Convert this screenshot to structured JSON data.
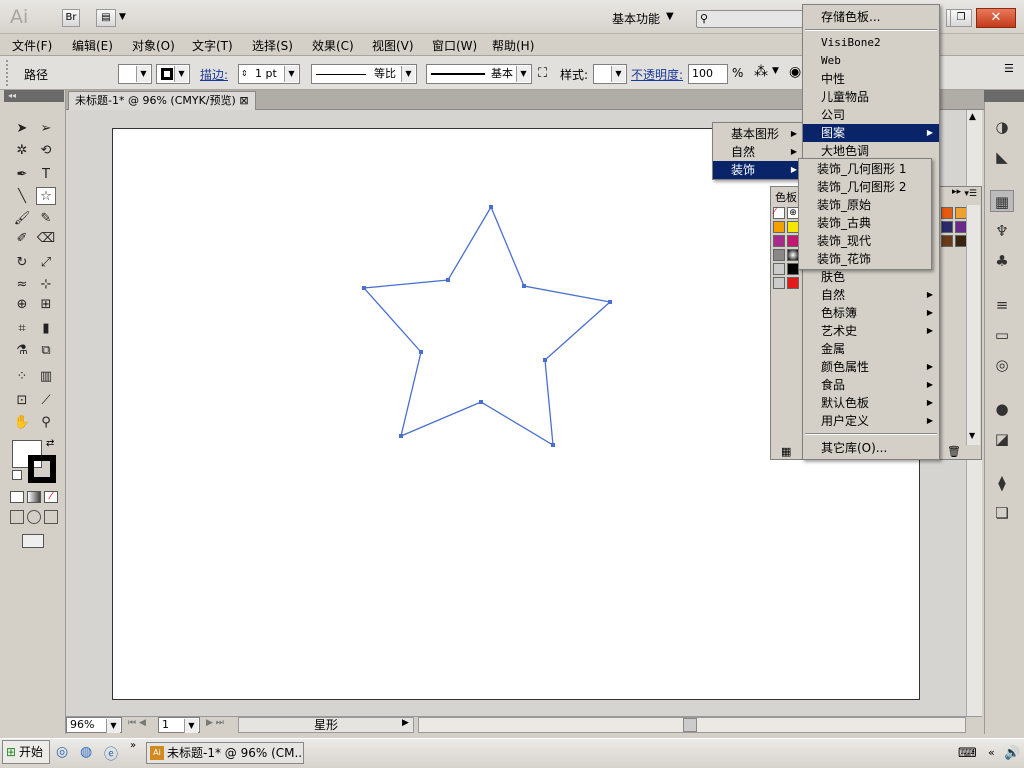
{
  "app": {
    "logo": "Ai",
    "bridge_label": "Br",
    "workspace": "基本功能"
  },
  "menubar": [
    "文件(F)",
    "编辑(E)",
    "对象(O)",
    "文字(T)",
    "选择(S)",
    "效果(C)",
    "视图(V)",
    "窗口(W)",
    "帮助(H)"
  ],
  "control": {
    "object_type": "路径",
    "stroke_label": "描边:",
    "stroke_weight": "1 pt",
    "profile_uniform": "等比",
    "brush_basic": "基本",
    "style_label": "样式:",
    "opacity_label": "不透明度:",
    "opacity_value": "100",
    "percent": "%"
  },
  "document": {
    "tab_title": "未标题-1* @ 96% (CMYK/预览)",
    "close": "⊠"
  },
  "status": {
    "zoom": "96%",
    "page": "1",
    "tool_name": "星形"
  },
  "swatch_panel": {
    "title": "色板"
  },
  "library_menu": {
    "top": "存储色板...",
    "items": [
      "VisiBone2",
      "Web",
      "中性",
      "儿童物品",
      "公司",
      "图案",
      "大地色调"
    ],
    "lower_items": [
      "肤色",
      "自然",
      "色标簿",
      "艺术史",
      "金属",
      "颜色属性",
      "食品",
      "默认色板",
      "用户定义"
    ],
    "lower_has_sub": [
      false,
      true,
      true,
      true,
      false,
      true,
      true,
      true,
      true
    ],
    "bottom": "其它库(O)...",
    "selected": "图案"
  },
  "pattern_submenu": {
    "items": [
      "基本图形",
      "自然",
      "装饰"
    ],
    "selected": "装饰"
  },
  "decor_submenu": {
    "items": [
      "装饰_几何图形 1",
      "装饰_几何图形 2",
      "装饰_原始",
      "装饰_古典",
      "装饰_现代",
      "装饰_花饰"
    ]
  },
  "taskbar": {
    "start": "开始",
    "item": "未标题-1* @ 96% (CM..."
  },
  "colors": {
    "star_stroke": "#4a6fd0",
    "menu_highlight": "#0a246a"
  }
}
